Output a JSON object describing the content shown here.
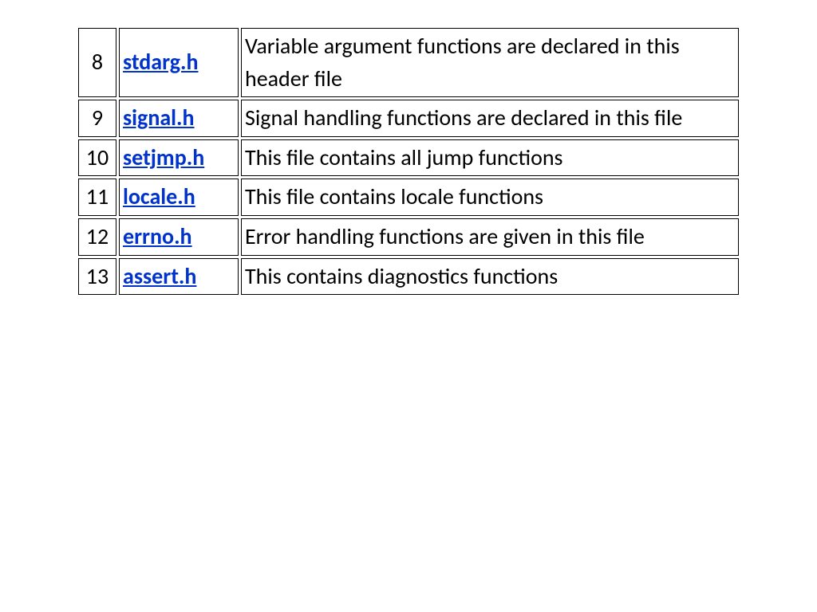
{
  "rows": [
    {
      "num": "8",
      "name": "stdarg.h",
      "desc": "Variable argument functions are declared in this header file"
    },
    {
      "num": "9",
      "name": "signal.h",
      "desc": "Signal handling functions are declared in this file"
    },
    {
      "num": "10",
      "name": "setjmp.h",
      "desc": "This file contains all jump functions"
    },
    {
      "num": "11",
      "name": "locale.h",
      "desc": "This file contains locale functions"
    },
    {
      "num": "12",
      "name": "errno.h",
      "desc": "Error handling functions are given in this file"
    },
    {
      "num": "13",
      "name": "assert.h",
      "desc": "This contains diagnostics functions"
    }
  ]
}
